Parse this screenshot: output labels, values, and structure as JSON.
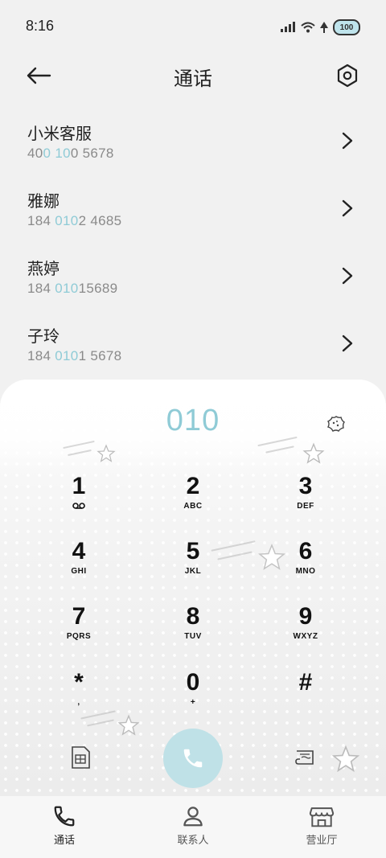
{
  "status_bar": {
    "time": "8:16",
    "battery": "100"
  },
  "header": {
    "title": "通话"
  },
  "contacts": [
    {
      "name": "小米客服",
      "number_parts": [
        "40",
        "0",
        " ",
        "10",
        "0 5678"
      ]
    },
    {
      "name": "雅娜",
      "number_parts": [
        "184 ",
        "010",
        "2 4685",
        "",
        ""
      ]
    },
    {
      "name": "燕婷",
      "number_parts": [
        "184 ",
        "010",
        "15689",
        "",
        ""
      ]
    },
    {
      "name": "子玲",
      "number_parts": [
        "184 ",
        "010",
        "1 5678",
        "",
        ""
      ]
    }
  ],
  "dialpad": {
    "display": "010",
    "keys": [
      {
        "digit": "1",
        "letters": ""
      },
      {
        "digit": "2",
        "letters": "ABC"
      },
      {
        "digit": "3",
        "letters": "DEF"
      },
      {
        "digit": "4",
        "letters": "GHI"
      },
      {
        "digit": "5",
        "letters": "JKL"
      },
      {
        "digit": "6",
        "letters": "MNO"
      },
      {
        "digit": "7",
        "letters": "PQRS"
      },
      {
        "digit": "8",
        "letters": "TUV"
      },
      {
        "digit": "9",
        "letters": "WXYZ"
      },
      {
        "digit": "*",
        "letters": ","
      },
      {
        "digit": "0",
        "letters": "+"
      },
      {
        "digit": "#",
        "letters": ""
      }
    ]
  },
  "bottom_nav": [
    {
      "label": "通话",
      "icon": "phone-icon"
    },
    {
      "label": "联系人",
      "icon": "person-icon"
    },
    {
      "label": "营业厅",
      "icon": "store-icon"
    }
  ],
  "colors": {
    "accent": "#8fcbd6",
    "call_button": "#bfe1e7",
    "background": "#f1f1f1"
  }
}
